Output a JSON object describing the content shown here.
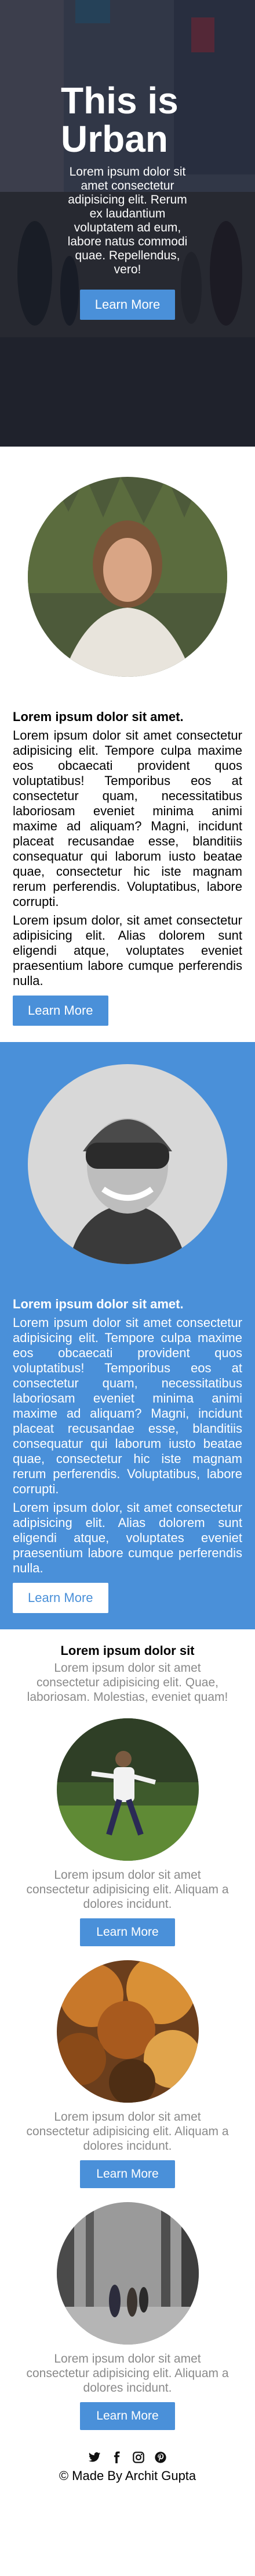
{
  "hero": {
    "title": "This is Urban",
    "text": "Lorem ipsum dolor sit amet consectetur adipisicing elit. Rerum ex laudantium voluptatem ad eum, labore natus commodi quae. Repellendus, vero!",
    "button": "Learn More"
  },
  "profiles": [
    {
      "heading": "Lorem ipsum dolor sit amet.",
      "para1": "Lorem ipsum dolor sit amet consectetur adipisicing elit. Tempore culpa maxime eos obcaecati provident quos voluptatibus! Temporibus eos at consectetur quam, necessitatibus laboriosam eveniet minima animi maxime ad aliquam? Magni, incidunt placeat recusandae esse, blanditiis consequatur qui laborum iusto beatae quae, consectetur hic iste magnam rerum perferendis. Voluptatibus, labore corrupti.",
      "para2": "Lorem ipsum dolor, sit amet consectetur adipisicing elit. Alias dolorem sunt eligendi atque, voluptates eveniet praesentium labore cumque perferendis nulla.",
      "button": "Learn More"
    },
    {
      "heading": "Lorem ipsum dolor sit amet.",
      "para1": "Lorem ipsum dolor sit amet consectetur adipisicing elit. Tempore culpa maxime eos obcaecati provident quos voluptatibus! Temporibus eos at consectetur quam, necessitatibus laboriosam eveniet minima animi maxime ad aliquam? Magni, incidunt placeat recusandae esse, blanditiis consequatur qui laborum iusto beatae quae, consectetur hic iste magnam rerum perferendis. Voluptatibus, labore corrupti.",
      "para2": "Lorem ipsum dolor, sit amet consectetur adipisicing elit. Alias dolorem sunt eligendi atque, voluptates eveniet praesentium labore cumque perferendis nulla.",
      "button": "Learn More"
    }
  ],
  "gallery": {
    "heading": "Lorem ipsum dolor sit",
    "subtext": "Lorem ipsum dolor sit amet consectetur adipisicing elit. Quae, laboriosam. Molestias, eveniet quam!",
    "cards": [
      {
        "text": "Lorem ipsum dolor sit amet consectetur adipisicing elit. Aliquam a dolores incidunt.",
        "button": "Learn More"
      },
      {
        "text": "Lorem ipsum dolor sit amet consectetur adipisicing elit. Aliquam a dolores incidunt.",
        "button": "Learn More"
      },
      {
        "text": "Lorem ipsum dolor sit amet consectetur adipisicing elit. Aliquam a dolores incidunt.",
        "button": "Learn More"
      }
    ]
  },
  "footer": {
    "social_icons": [
      "twitter-icon",
      "facebook-icon",
      "instagram-icon",
      "pinterest-icon"
    ],
    "credit": "© Made By Archit Gupta"
  },
  "colors": {
    "accent": "#4a90d9",
    "muted_text": "#8a8a8a"
  }
}
